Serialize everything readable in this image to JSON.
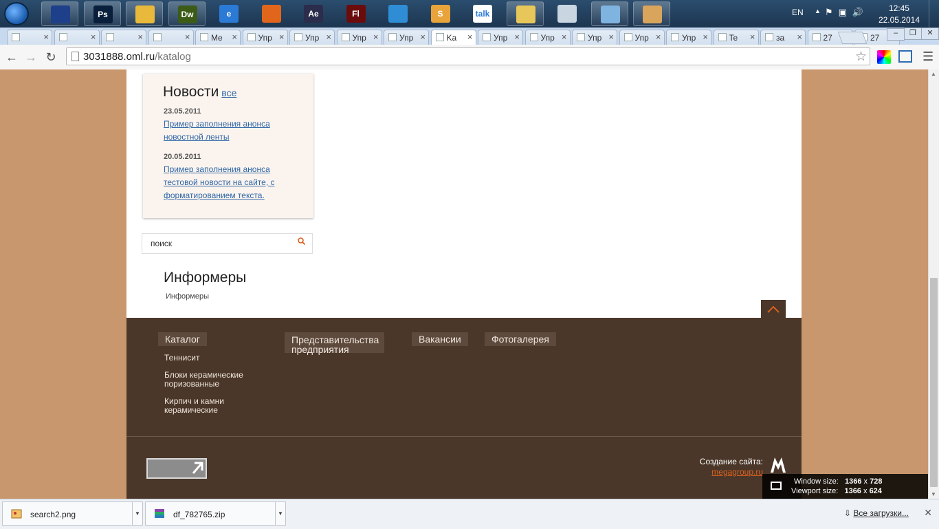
{
  "taskbar": {
    "apps": [
      {
        "name": "save-app",
        "label": "",
        "color": "#1e3f8a"
      },
      {
        "name": "photoshop-app",
        "label": "Ps",
        "color": "#0a1f3b"
      },
      {
        "name": "chrome-app",
        "label": "",
        "color": "#e8b93a"
      },
      {
        "name": "dreamweaver-app",
        "label": "Dw",
        "color": "#3c5b17"
      },
      {
        "name": "ie-app",
        "label": "e",
        "color": "#2a7ad6"
      },
      {
        "name": "firefox-app",
        "label": "",
        "color": "#e1661c"
      },
      {
        "name": "aftereffects-app",
        "label": "Ae",
        "color": "#2c2c4c"
      },
      {
        "name": "flash-app",
        "label": "Fl",
        "color": "#6b0c0c"
      },
      {
        "name": "media-app",
        "label": "",
        "color": "#2f8dd6"
      },
      {
        "name": "notes-app",
        "label": "S",
        "color": "#e8a43a"
      },
      {
        "name": "talk-app",
        "label": "talk",
        "color": "#ffffff"
      },
      {
        "name": "explorer-app",
        "label": "",
        "color": "#e8c75a"
      },
      {
        "name": "calculator-app",
        "label": "",
        "color": "#c9d6e2"
      },
      {
        "name": "notepad-app",
        "label": "",
        "color": "#7fb3e0"
      },
      {
        "name": "paint-app",
        "label": "",
        "color": "#d9a45c"
      }
    ],
    "language": "EN",
    "time": "12:45",
    "date": "22.05.2014"
  },
  "tabs": [
    {
      "label": "",
      "active": false
    },
    {
      "label": "",
      "active": false
    },
    {
      "label": "",
      "active": false
    },
    {
      "label": "",
      "active": false
    },
    {
      "label": "Me",
      "active": false
    },
    {
      "label": "Упр",
      "active": false
    },
    {
      "label": "Упр",
      "active": false
    },
    {
      "label": "Упр",
      "active": false
    },
    {
      "label": "Упр",
      "active": false
    },
    {
      "label": "Ka",
      "active": true
    },
    {
      "label": "Упр",
      "active": false
    },
    {
      "label": "Упр",
      "active": false
    },
    {
      "label": "Упр",
      "active": false
    },
    {
      "label": "Упр",
      "active": false
    },
    {
      "label": "Упр",
      "active": false
    },
    {
      "label": "Te",
      "active": false
    },
    {
      "label": "за",
      "active": false
    },
    {
      "label": "27",
      "active": false
    },
    {
      "label": "27",
      "active": false
    }
  ],
  "address": {
    "host": "3031888.oml.ru",
    "path": "/katalog"
  },
  "news": {
    "title": "Новости",
    "all_link": "все",
    "items": [
      {
        "date": "23.05.2011",
        "text": "Пример заполнения анонса новостной ленты"
      },
      {
        "date": "20.05.2011",
        "text": "Пример заполнения анонса тестовой новости на сайте, с форматированием текста."
      }
    ]
  },
  "search": {
    "placeholder": "поиск"
  },
  "informers": {
    "title": "Информеры",
    "text": "Информеры"
  },
  "footer": {
    "menus": [
      {
        "label": "Каталог",
        "sub": [
          "Теннисит",
          "Блоки керамические поризованные",
          "Кирпич и камни керамические"
        ]
      },
      {
        "label": "Представительства предприятия",
        "sub": []
      },
      {
        "label": "Вакансии",
        "sub": []
      },
      {
        "label": "Фотогалерея",
        "sub": []
      }
    ],
    "creator_label": "Создание сайта:",
    "creator_link": "megagroup.ru"
  },
  "window_size": {
    "window_label": "Window size:",
    "window_w": "1366",
    "window_h": "728",
    "viewport_label": "Viewport size:",
    "viewport_w": "1366",
    "viewport_h": "624",
    "separator": "x"
  },
  "downloads": {
    "items": [
      {
        "name": "search2.png"
      },
      {
        "name": "df_782765.zip"
      }
    ],
    "all_label": "Все загрузки..."
  },
  "colors": {
    "page_bg": "#c9976e",
    "footer_bg": "#4a3729",
    "link": "#2f66a8",
    "accent": "#d9611e"
  }
}
